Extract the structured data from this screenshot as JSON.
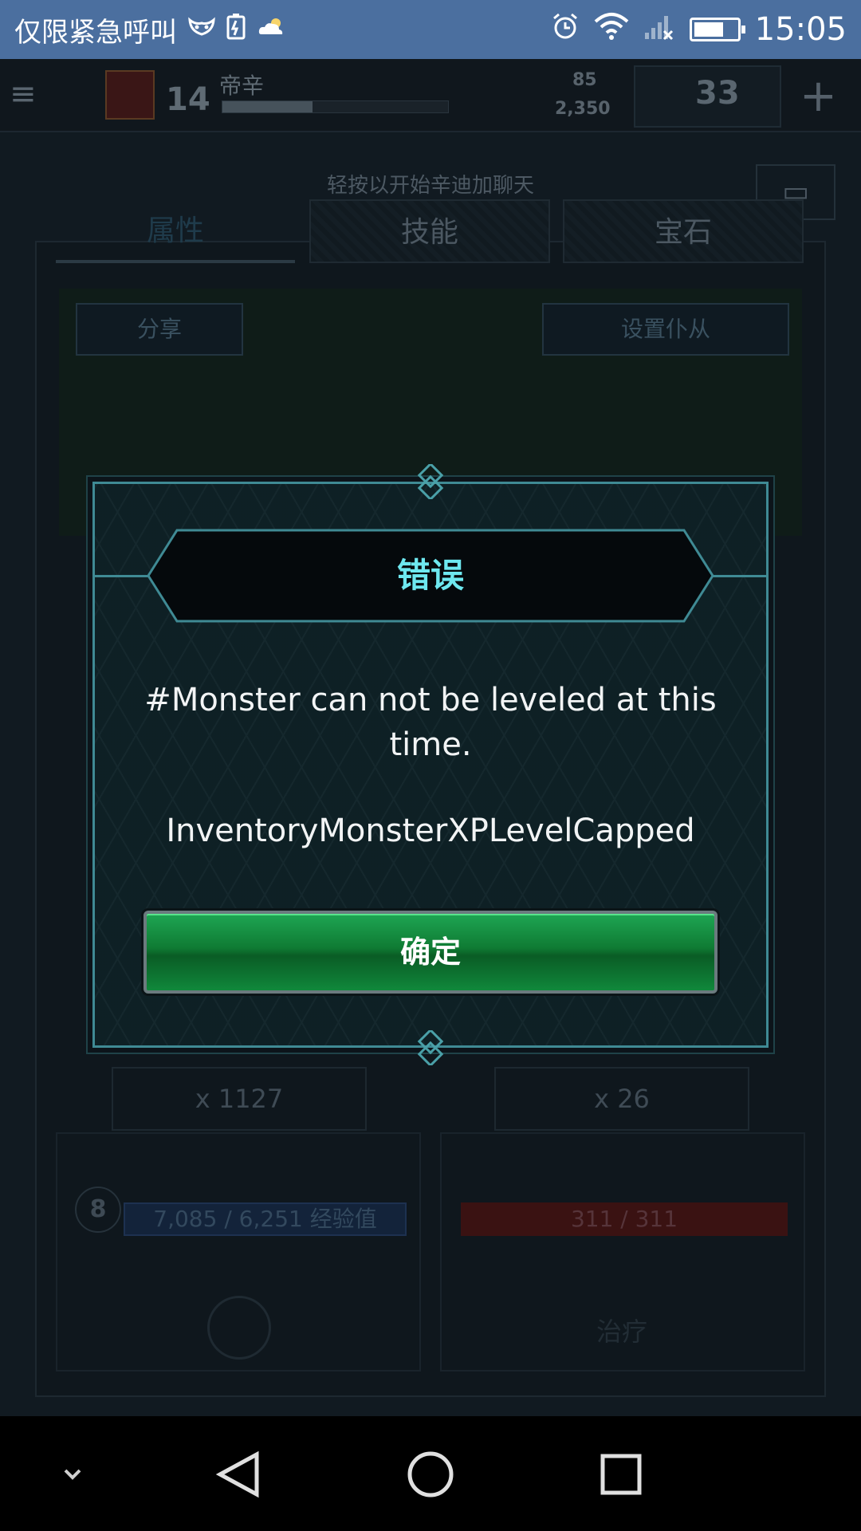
{
  "status_bar": {
    "carrier": "仅限紧急呼叫",
    "clock": "15:05",
    "icons": [
      "mask-icon",
      "battery-alert-icon",
      "weather-cloud-icon",
      "alarm-icon",
      "wifi-icon",
      "no-signal-icon",
      "battery-icon"
    ]
  },
  "game": {
    "player_level": "14",
    "player_name": "帝辛",
    "gems": "85",
    "gold": "2,350",
    "energy": "33",
    "chat_hint": "轻按以开始辛迪加聊天",
    "tabs": [
      "属性",
      "技能",
      "宝石"
    ],
    "share_label": "分享",
    "set_minion_label": "设置仆从",
    "xp_item_count": "x 1127",
    "heal_item_count": "x 26",
    "monster_level": "8",
    "xp_text": "7,085 / 6,251 经验值",
    "hp_text": "311 / 311",
    "heal_label": "治疗"
  },
  "dialog": {
    "title": "错误",
    "message": "#Monster can not be leveled at this time.",
    "code": "InventoryMonsterXPLevelCapped",
    "confirm_label": "确定"
  },
  "colors": {
    "status_bar": "#4b6f9f",
    "dialog_border": "#3f8a94",
    "title_text": "#6ee8f0",
    "button_green": "#0f7a33"
  }
}
